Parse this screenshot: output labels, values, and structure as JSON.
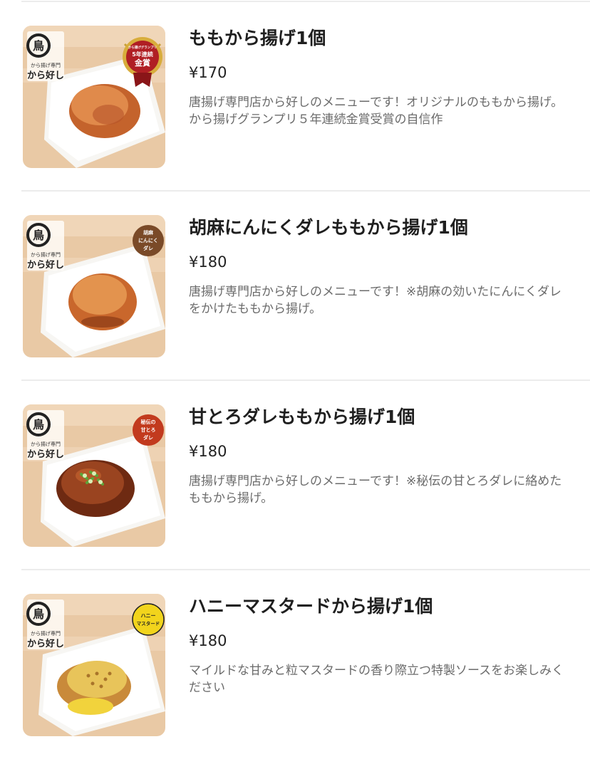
{
  "items": [
    {
      "name": "ももから揚げ1個",
      "price": "¥170",
      "description": "唐揚げ専門店から好しのメニューです！オリジナルのももから揚げ。から揚げグランプリ５年連続金賞受賞の自信作",
      "badge": {
        "type": "award",
        "lines": [
          "から揚げグランプリ",
          "5年連続",
          "金賞"
        ]
      },
      "logo": {
        "mark": "鳥",
        "sub": "から揚げ専門",
        "brand": "から好し"
      }
    },
    {
      "name": "胡麻にんにくダレももから揚げ1個",
      "price": "¥180",
      "description": "唐揚げ専門店から好しのメニューです！※胡麻の効いたにんにくダレをかけたももから揚げ。",
      "badge": {
        "type": "circle",
        "color": "#7a4a28",
        "lines": [
          "胡麻",
          "にんにく",
          "ダレ"
        ]
      },
      "logo": {
        "mark": "鳥",
        "sub": "から揚げ専門",
        "brand": "から好し"
      }
    },
    {
      "name": "甘とろダレももから揚げ1個",
      "price": "¥180",
      "description": "唐揚げ専門店から好しのメニューです！※秘伝の甘とろダレに絡めたももから揚げ。",
      "badge": {
        "type": "circle",
        "color": "#c23a1e",
        "lines": [
          "秘伝の",
          "甘とろ",
          "ダレ"
        ]
      },
      "logo": {
        "mark": "鳥",
        "sub": "から揚げ専門",
        "brand": "から好し"
      }
    },
    {
      "name": "ハニーマスタードから揚げ1個",
      "price": "¥180",
      "description": "マイルドな甘みと粒マスタードの香り際立つ特製ソースをお楽しみください",
      "badge": {
        "type": "circle",
        "color": "#f2d41c",
        "lines": [
          "ハニー",
          "マスタード"
        ]
      },
      "logo": {
        "mark": "鳥",
        "sub": "から揚げ専門",
        "brand": "から好し"
      }
    }
  ]
}
